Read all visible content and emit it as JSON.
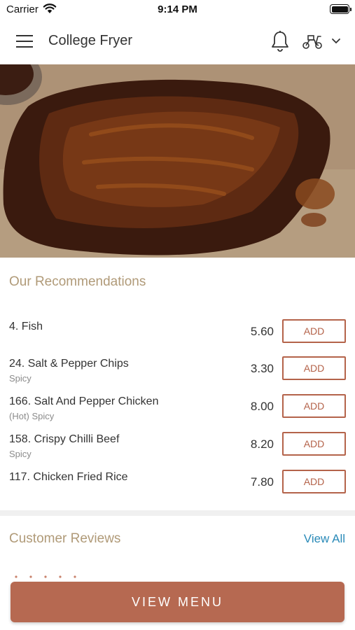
{
  "status_bar": {
    "carrier": "Carrier",
    "time": "9:14 PM"
  },
  "header": {
    "title": "College Fryer",
    "icons": [
      "menu-icon",
      "bell-icon",
      "scooter-icon",
      "chevron-down-icon"
    ]
  },
  "hero": {
    "image": "bbq-ribs-photo"
  },
  "recommendations": {
    "title": "Our Recommendations",
    "add_label": "ADD",
    "items": [
      {
        "name": "4. Fish",
        "note": "",
        "price": "5.60"
      },
      {
        "name": "24. Salt & Pepper Chips",
        "note": "Spicy",
        "price": "3.30"
      },
      {
        "name": "166. Salt And Pepper Chicken",
        "note": "(Hot) Spicy",
        "price": "8.00"
      },
      {
        "name": "158. Crispy Chilli Beef",
        "note": "Spicy",
        "price": "8.20"
      },
      {
        "name": "117. Chicken Fried Rice",
        "note": "",
        "price": "7.80"
      }
    ]
  },
  "reviews": {
    "title": "Customer Reviews",
    "view_all_label": "View All"
  },
  "footer": {
    "view_menu_label": "VIEW MENU"
  },
  "colors": {
    "accent": "#b66951",
    "section_title": "#b09a78",
    "link": "#2a8ab8"
  }
}
